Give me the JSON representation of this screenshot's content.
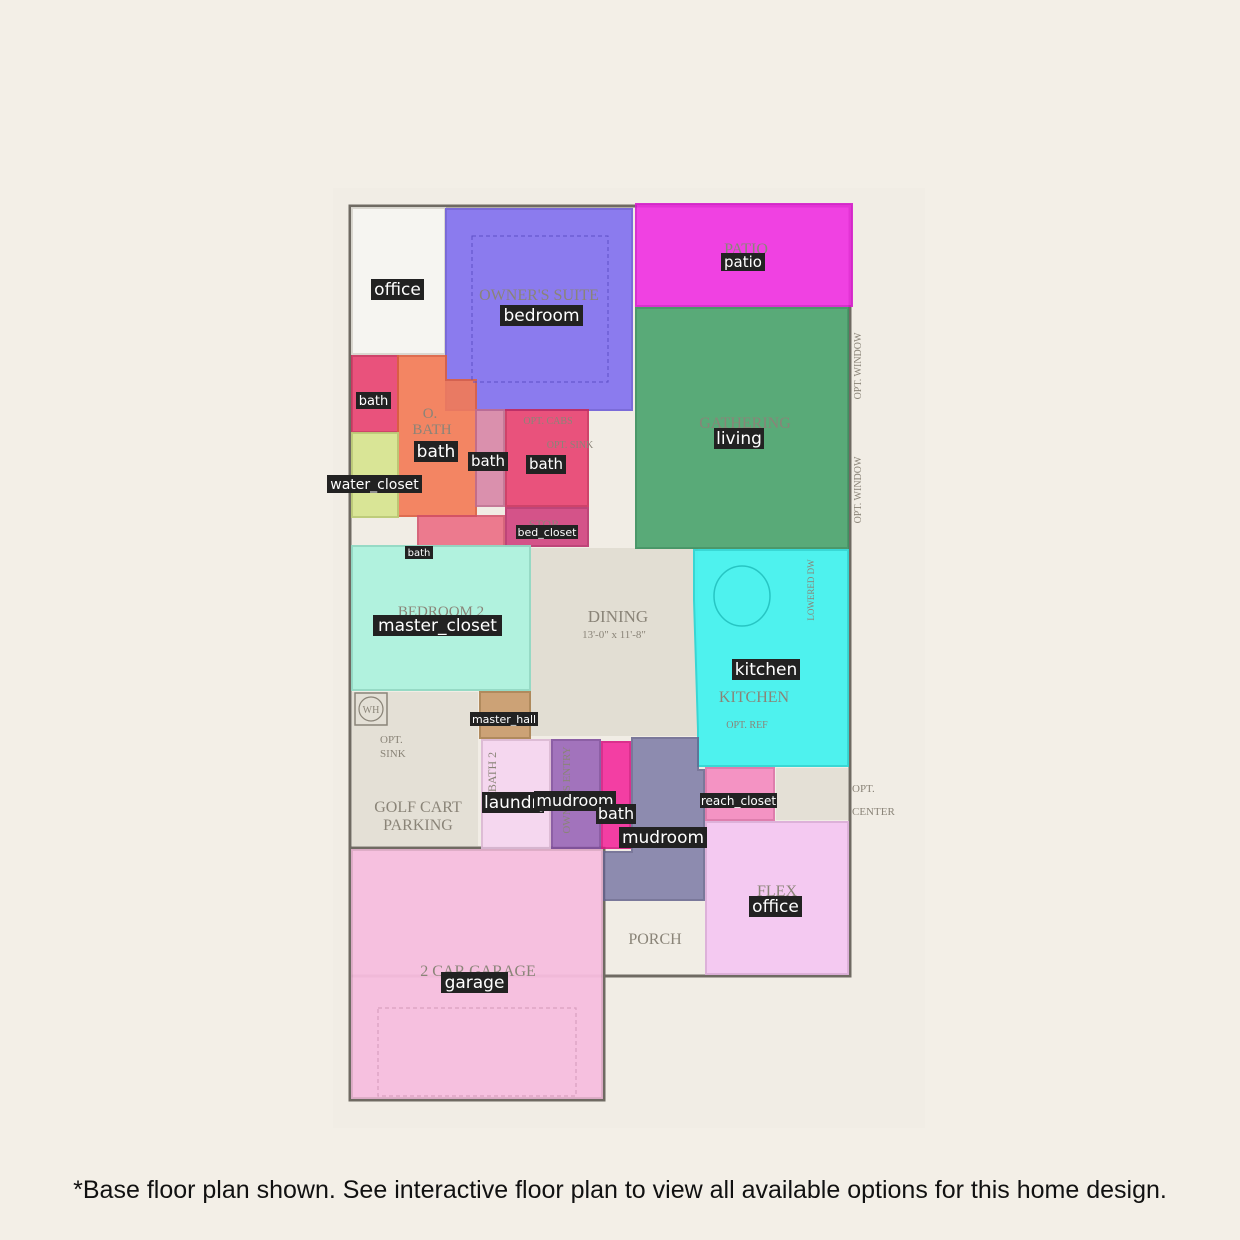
{
  "plan_labels": {
    "patio": "PATIO",
    "owners_suite": "OWNER'S SUITE",
    "gathering": "GATHERING",
    "o_bath_line1": "O.",
    "o_bath_line2": "BATH",
    "opt_cabs": "OPT. CABS",
    "opt_sink": "OPT. SINK",
    "stor": "STOR",
    "bedroom2": "BEDROOM 2",
    "dining": "DINING",
    "dining_size": "13'-0\" x 11'-8\"",
    "kitchen": "KITCHEN",
    "opt_ref": "OPT. REF",
    "lowered_dw": "LOWERED DW",
    "opt_window_1": "OPT. WINDOW",
    "opt_window_2": "OPT. WINDOW",
    "wh": "WH",
    "opt_sink2_line1": "OPT.",
    "opt_sink2_line2": "SINK",
    "golf_line1": "GOLF CART",
    "golf_line2": "PARKING",
    "bath2": "BATH 2",
    "owners_entry": "OWNER'S ENTRY",
    "opt_center_line1": "OPT.",
    "opt_center_line2": "CENTER",
    "flex": "FLEX",
    "porch": "PORCH",
    "garage": "2 CAR GARAGE"
  },
  "room_tags": [
    {
      "id": "office-1",
      "text": "office",
      "fill": "#f7f6f2"
    },
    {
      "id": "bedroom-1",
      "text": "bedroom",
      "fill": "#7d6cf0"
    },
    {
      "id": "patio-1",
      "text": "patio",
      "fill": "#f02fe2"
    },
    {
      "id": "living-1",
      "text": "living",
      "fill": "#3f9f66"
    },
    {
      "id": "bath-1",
      "text": "bath",
      "fill": "#e8386a"
    },
    {
      "id": "bath-2",
      "text": "bath",
      "fill": "#f47a55"
    },
    {
      "id": "bath-3",
      "text": "bath",
      "fill": "#d887a8"
    },
    {
      "id": "bath-4",
      "text": "bath",
      "fill": "#e8386a"
    },
    {
      "id": "water-closet-1",
      "text": "water_closet",
      "fill": "#d8e592"
    },
    {
      "id": "bed-closet-1",
      "text": "bed_closet",
      "fill": "#d0397a"
    },
    {
      "id": "bath-5",
      "text": "bath",
      "fill": "#ec6680"
    },
    {
      "id": "master-closet-1",
      "text": "master_closet",
      "fill": "#aef3de"
    },
    {
      "id": "kitchen-1",
      "text": "kitchen",
      "fill": "#3df3f0"
    },
    {
      "id": "master-hall-1",
      "text": "master_hall",
      "fill": "#c89a6a"
    },
    {
      "id": "laundry-1",
      "text": "laundry",
      "fill": "#f6d6f0"
    },
    {
      "id": "mudroom-1",
      "text": "mudroom",
      "fill": "#9a66b8"
    },
    {
      "id": "bath-6",
      "text": "bath",
      "fill": "#f42c9c"
    },
    {
      "id": "mudroom-2",
      "text": "mudroom",
      "fill": "#7c7aa6"
    },
    {
      "id": "reach-closet-1",
      "text": "reach_closet",
      "fill": "#f58ac0"
    },
    {
      "id": "office-2",
      "text": "office",
      "fill": "#f5c8f2"
    },
    {
      "id": "garage-1",
      "text": "garage",
      "fill": "#f7bedf"
    }
  ],
  "footer": "*Base floor plan shown. See interactive floor plan to view all available options for this home design."
}
